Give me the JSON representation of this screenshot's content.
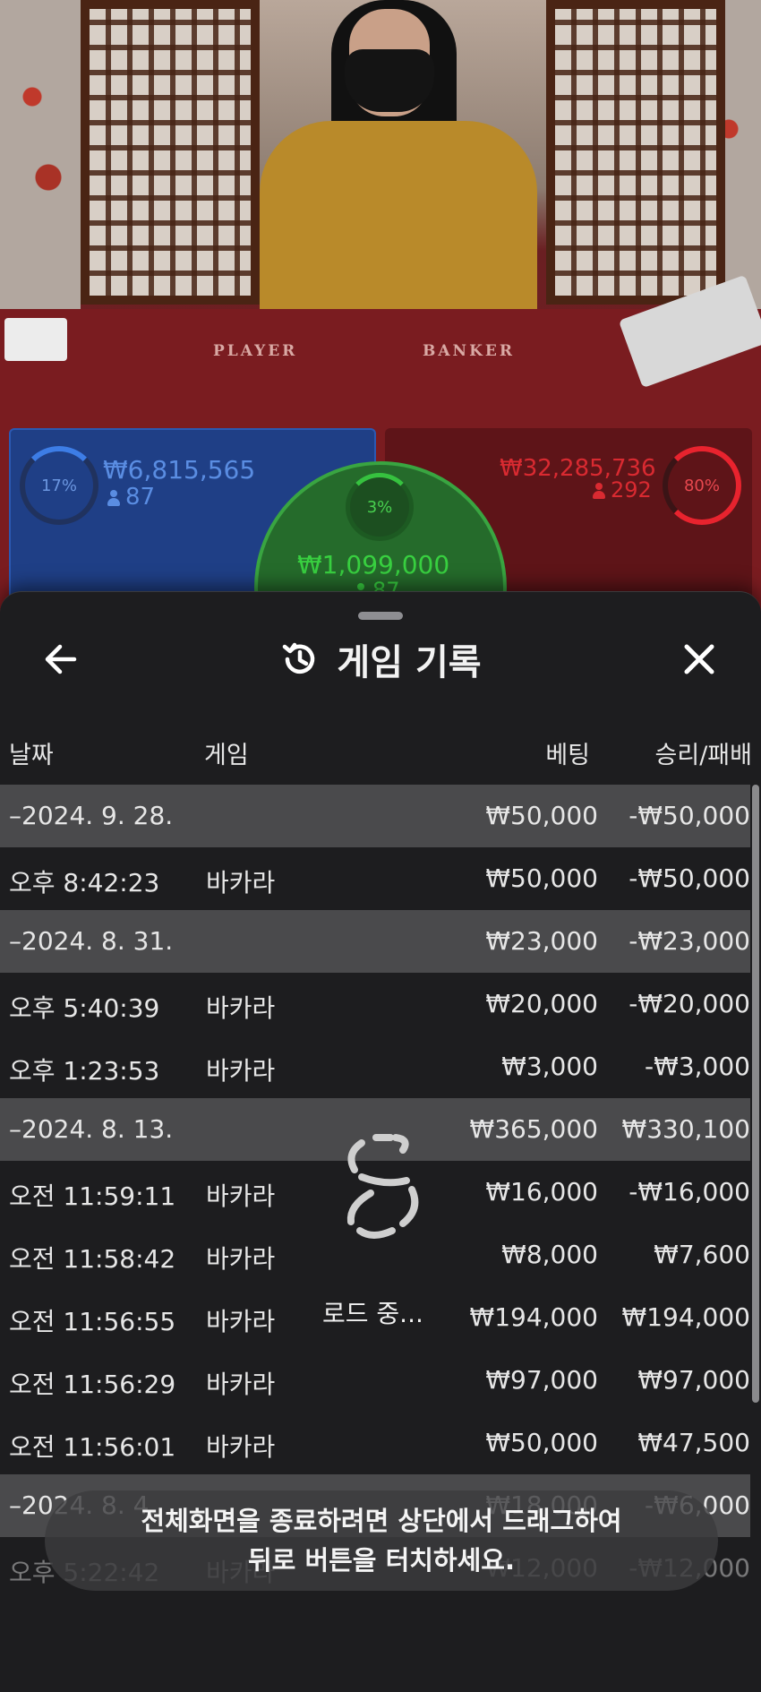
{
  "live": {
    "felt_player": "PLAYER",
    "felt_banker": "BANKER",
    "player": {
      "pct": "17%",
      "amount": "₩6,815,565",
      "count": "87",
      "color": "#5a8de2"
    },
    "banker": {
      "pct": "80%",
      "amount": "₩32,285,736",
      "count": "292",
      "color": "#d92a31"
    },
    "tie": {
      "pct": "3%",
      "amount": "₩1,099,000",
      "count": "87",
      "color": "#38d040"
    }
  },
  "sheet": {
    "title": "게임 기록",
    "back_icon": "arrow-left-icon",
    "history_icon": "history-icon",
    "close_icon": "close-icon",
    "columns": {
      "date": "날짜",
      "game": "게임",
      "bet": "베팅",
      "win": "승리/패배"
    },
    "rows": [
      {
        "type": "group",
        "date": "–2024. 9. 28.",
        "game": "",
        "bet": "₩50,000",
        "win": "-₩50,000"
      },
      {
        "type": "item",
        "date": "오후 8:42:23",
        "game": "바카라",
        "bet": "₩50,000",
        "win": "-₩50,000"
      },
      {
        "type": "group",
        "date": "–2024. 8. 31.",
        "game": "",
        "bet": "₩23,000",
        "win": "-₩23,000"
      },
      {
        "type": "item",
        "date": "오후 5:40:39",
        "game": "바카라",
        "bet": "₩20,000",
        "win": "-₩20,000"
      },
      {
        "type": "item",
        "date": "오후 1:23:53",
        "game": "바카라",
        "bet": "₩3,000",
        "win": "-₩3,000"
      },
      {
        "type": "group",
        "date": "–2024. 8. 13.",
        "game": "",
        "bet": "₩365,000",
        "win": "₩330,100"
      },
      {
        "type": "item",
        "date": "오전 11:59:11",
        "game": "바카라",
        "bet": "₩16,000",
        "win": "-₩16,000"
      },
      {
        "type": "item",
        "date": "오전 11:58:42",
        "game": "바카라",
        "bet": "₩8,000",
        "win": "₩7,600"
      },
      {
        "type": "item",
        "date": "오전 11:56:55",
        "game": "바카라",
        "bet": "₩194,000",
        "win": "₩194,000"
      },
      {
        "type": "item",
        "date": "오전 11:56:29",
        "game": "바카라",
        "bet": "₩97,000",
        "win": "₩97,000"
      },
      {
        "type": "item",
        "date": "오전 11:56:01",
        "game": "바카라",
        "bet": "₩50,000",
        "win": "₩47,500"
      },
      {
        "type": "group",
        "date": "–2024. 8. 4.",
        "game": "",
        "bet": "₩18,000",
        "win": "-₩6,000"
      },
      {
        "type": "item",
        "date": "오후 5:22:42",
        "game": "바카라",
        "bet": "₩12,000",
        "win": "-₩12,000"
      }
    ],
    "loading_text": "로드 중..."
  },
  "toast": {
    "line1": "전체화면을 종료하려면 상단에서 드래그하여",
    "line2": "뒤로 버튼을 터치하세요."
  }
}
